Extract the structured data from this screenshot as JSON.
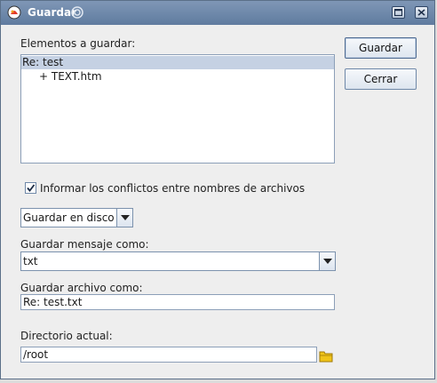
{
  "window": {
    "title": "Guardar"
  },
  "items_label": "Elementos a guardar:",
  "items": [
    {
      "label": "Re: test",
      "selected": true,
      "indent": 0
    },
    {
      "label": "+ TEXT.htm",
      "selected": false,
      "indent": 1
    }
  ],
  "buttons": {
    "save": "Guardar",
    "close": "Cerrar"
  },
  "checkbox": {
    "label": "Informar los conflictos entre nombres de archivos",
    "checked": true
  },
  "save_target": {
    "value": "Guardar en disco"
  },
  "message_as": {
    "label": "Guardar mensaje como:",
    "value": "txt"
  },
  "file_as": {
    "label": "Guardar archivo como:",
    "value": "Re: test.txt"
  },
  "directory": {
    "label": "Directorio actual:",
    "value": "/root"
  },
  "icons": [
    "app-icon",
    "swirl-icon",
    "maximize-icon",
    "close-icon",
    "chevron-down-icon",
    "checkmark-icon",
    "folder-icon"
  ],
  "colors": {
    "titlebar": "#6f89ab",
    "selection": "#c5d1e3",
    "folder": "#f0c419"
  }
}
